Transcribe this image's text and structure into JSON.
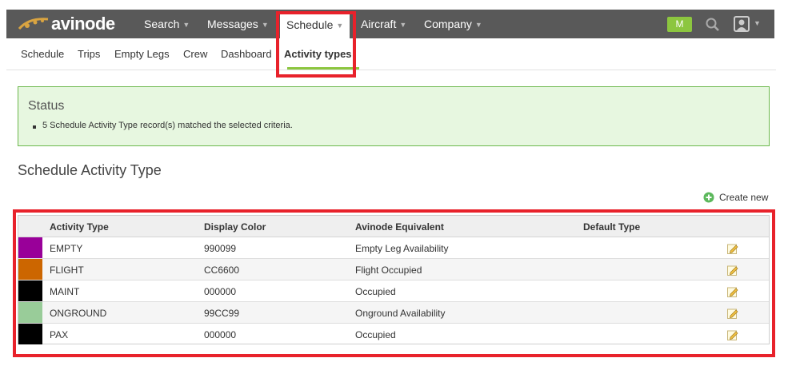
{
  "brand": {
    "name": "avinode"
  },
  "topnav": {
    "items": [
      {
        "label": "Search"
      },
      {
        "label": "Messages"
      },
      {
        "label": "Schedule"
      },
      {
        "label": "Aircraft"
      },
      {
        "label": "Company"
      }
    ],
    "user_badge": "M"
  },
  "subnav": {
    "items": [
      {
        "label": "Schedule"
      },
      {
        "label": "Trips"
      },
      {
        "label": "Empty Legs"
      },
      {
        "label": "Crew"
      },
      {
        "label": "Dashboard"
      },
      {
        "label": "Activity types"
      }
    ]
  },
  "status": {
    "title": "Status",
    "message": "5 Schedule Activity Type record(s) matched the selected criteria."
  },
  "section": {
    "title": "Schedule Activity Type",
    "create_label": "Create new"
  },
  "table": {
    "headers": [
      "Activity Type",
      "Display Color",
      "Avinode Equivalent",
      "Default Type"
    ],
    "rows": [
      {
        "swatch": "#990099",
        "type": "EMPTY",
        "color": "990099",
        "equivalent": "Empty Leg Availability",
        "default": ""
      },
      {
        "swatch": "#CC6600",
        "type": "FLIGHT",
        "color": "CC6600",
        "equivalent": "Flight Occupied",
        "default": ""
      },
      {
        "swatch": "#000000",
        "type": "MAINT",
        "color": "000000",
        "equivalent": "Occupied",
        "default": ""
      },
      {
        "swatch": "#99CC99",
        "type": "ONGROUND",
        "color": "99CC99",
        "equivalent": "Onground Availability",
        "default": ""
      },
      {
        "swatch": "#000000",
        "type": "PAX",
        "color": "000000",
        "equivalent": "Occupied",
        "default": ""
      }
    ]
  },
  "colors": {
    "topbar": "#595959",
    "accent_green": "#8cc63f",
    "highlight_red": "#e8222b",
    "status_bg": "#e7f7e0"
  },
  "icons": [
    "logo-mark-icon",
    "search-icon",
    "user-icon",
    "plus-circle-icon",
    "edit-pencil-icon",
    "caret-down-icon"
  ]
}
